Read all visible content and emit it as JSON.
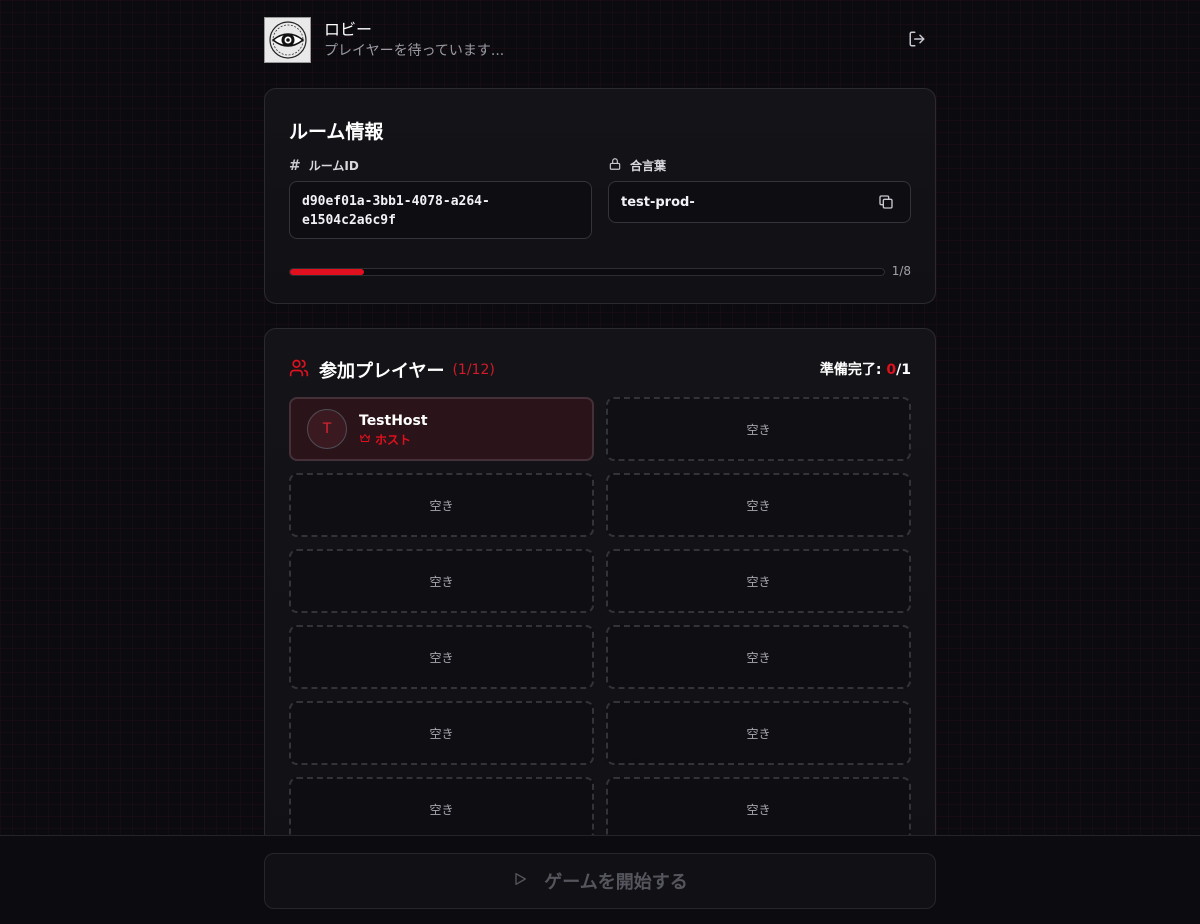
{
  "header": {
    "title": "ロビー",
    "subtitle": "プレイヤーを待っています..."
  },
  "room": {
    "title": "ルーム情報",
    "room_id_label": "ルームID",
    "room_id_line1": "d90ef01a-3bb1-4078-a264-",
    "room_id_line2": "e1504c2a6c9f",
    "password_label": "合言葉",
    "password_value": "test-prod-",
    "progress_text": "1/8",
    "progress_fraction": 0.125
  },
  "players": {
    "title": "参加プレイヤー",
    "count": "(1/12)",
    "ready_label": "準備完了: ",
    "ready_num": "0",
    "ready_total": "/1",
    "host": {
      "initial": "T",
      "name": "TestHost",
      "role": "ホスト"
    },
    "empty_label": "空き"
  },
  "footer": {
    "start_label": "ゲームを開始する"
  },
  "colors": {
    "accent": "#e0101e",
    "background": "#0b0b0f"
  }
}
